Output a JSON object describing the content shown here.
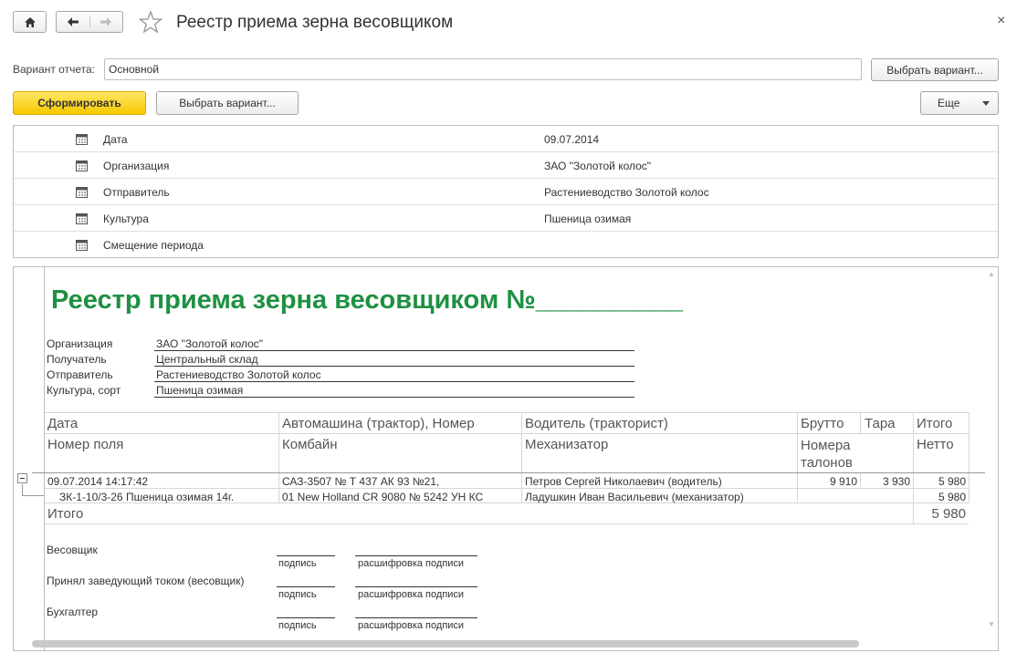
{
  "window": {
    "title": "Реестр приема зерна весовщиком",
    "close_glyph": "×"
  },
  "variant": {
    "label": "Вариант отчета:",
    "value": "Основной",
    "choose_button": "Выбрать вариант..."
  },
  "toolbar": {
    "form_button": "Сформировать",
    "choose_button": "Выбрать вариант...",
    "more_button": "Еще"
  },
  "settings": [
    {
      "label": "Дата",
      "value": "09.07.2014"
    },
    {
      "label": "Организация",
      "value": "ЗАО \"Золотой колос\""
    },
    {
      "label": "Отправитель",
      "value": "Растениеводство Золотой колос"
    },
    {
      "label": "Культура",
      "value": "Пшеница озимая"
    },
    {
      "label": "Смещение периода",
      "value": ""
    }
  ],
  "report": {
    "title": "Реестр приема зерна весовщиком №__________",
    "header": [
      {
        "label": "Организация",
        "value": "ЗАО \"Золотой колос\""
      },
      {
        "label": "Получатель",
        "value": "Центральный склад"
      },
      {
        "label": "Отправитель",
        "value": "Растениеводство Золотой колос"
      },
      {
        "label": "Культура, сорт",
        "value": "Пшеница озимая"
      }
    ],
    "columns_top": [
      "Дата",
      "Автомашина (трактор), Номер",
      "Водитель (тракторист)",
      "Брутто",
      "Тара",
      "Итого"
    ],
    "columns_bottom": [
      "Номер поля",
      "Комбайн",
      "Механизатор",
      "Номера талонов",
      "",
      "Нетто"
    ],
    "rows": [
      {
        "date": "09.07.2014 14:17:42",
        "vehicle": "САЗ-3507 № Т 437 АК 93 №21,",
        "driver": "Петров Сергей Николаевич (водитель)",
        "gross": "9 910",
        "tare": "3 930",
        "total": "5 980"
      },
      {
        "date": "ЗК-1-10/3-26 Пшеница озимая 14г.",
        "vehicle": "01 New Holland CR 9080 № 5242 УН КС",
        "driver": "Ладушкин Иван Васильевич (механизатор)",
        "gross": "",
        "tare": "",
        "total": "5 980"
      }
    ],
    "total_label": "Итого",
    "total_value": "5 980",
    "signatures": [
      {
        "role": "Весовщик",
        "sign": "подпись",
        "decode": "расшифровка подписи"
      },
      {
        "role": "Принял заведующий током (весовщик)",
        "sign": "подпись",
        "decode": "расшифровка подписи"
      },
      {
        "role": "Бухгалтер",
        "sign": "подпись",
        "decode": "расшифровка подписи"
      }
    ]
  }
}
